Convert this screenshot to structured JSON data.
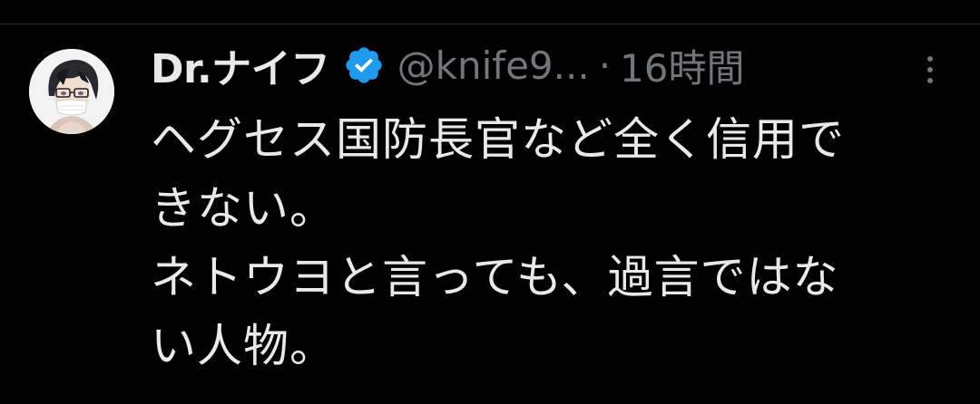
{
  "tweet": {
    "author": {
      "display_name": "Dr.ナイフ",
      "handle": "@knife9...",
      "verified": true
    },
    "separator": "·",
    "timestamp": "16時間",
    "text_lines": [
      "ヘグセス国防長官など全く信用で",
      "きない。",
      "ネトウヨと言っても、過言ではな",
      "い人物。"
    ]
  },
  "colors": {
    "background": "#000000",
    "text_primary": "#e7e9ea",
    "text_secondary": "#71767b",
    "verified_badge": "#1d9bf0"
  },
  "icons": {
    "verified": "verified-badge-icon",
    "more": "more-options-icon"
  }
}
